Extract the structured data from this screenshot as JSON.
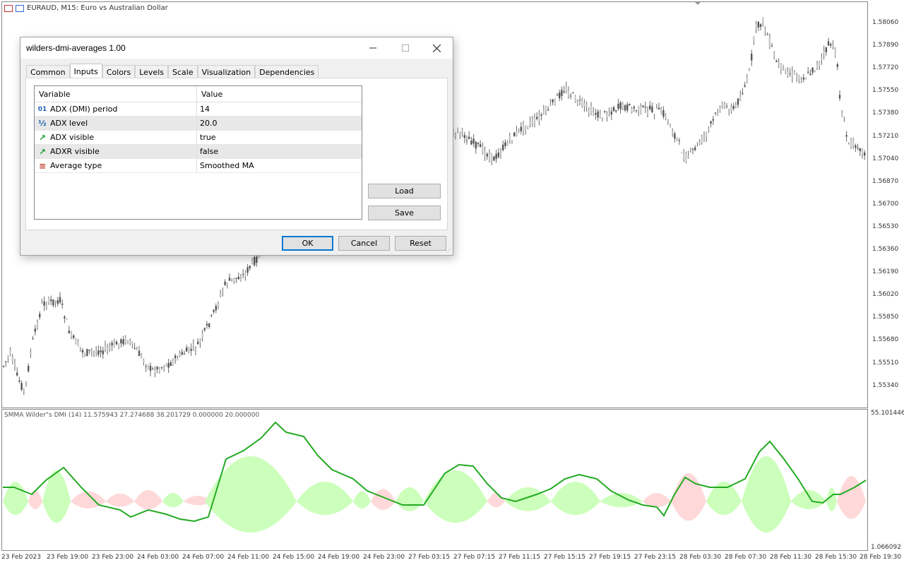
{
  "chart": {
    "title": "EURAUD, M15:  Euro vs Australian Dollar",
    "indicator_label": "SMMA Wilder\"s DMI (14) 11.575943 27.274688 38.201729 0.000000 20.000000",
    "price_axis": [
      "1.58060",
      "1.57890",
      "1.57720",
      "1.57550",
      "1.57380",
      "1.57210",
      "1.57040",
      "1.56870",
      "1.56700",
      "1.56530",
      "1.56360",
      "1.56190",
      "1.56020",
      "1.55850",
      "1.55680",
      "1.55510",
      "1.55340"
    ],
    "indicator_axis": {
      "max": "55.101446",
      "min": "1.066092"
    },
    "time_axis": [
      "23 Feb 2023",
      "23 Feb 19:00",
      "23 Feb 23:00",
      "24 Feb 03:00",
      "24 Feb 07:00",
      "24 Feb 11:00",
      "24 Feb 15:00",
      "24 Feb 19:00",
      "24 Feb 23:00",
      "27 Feb 03:15",
      "27 Feb 07:15",
      "27 Feb 11:15",
      "27 Feb 15:15",
      "27 Feb 19:15",
      "27 Feb 23:15",
      "28 Feb 03:30",
      "28 Feb 07:30",
      "28 Feb 11:30",
      "28 Feb 15:30",
      "28 Feb 19:30"
    ],
    "colors": {
      "bull_fill": "#ccffbb",
      "bear_fill": "#ffd9d9",
      "adx_line": "#22aa22",
      "candle": "#555555"
    }
  },
  "dialog": {
    "title": "wilders-dmi-averages 1.00",
    "tabs": [
      "Common",
      "Inputs",
      "Colors",
      "Levels",
      "Scale",
      "Visualization",
      "Dependencies"
    ],
    "active_tab": "Inputs",
    "columns": {
      "variable": "Variable",
      "value": "Value"
    },
    "rows": [
      {
        "icon": "01",
        "icon_name": "integer-icon",
        "variable": "ADX (DMI) period",
        "value": "14"
      },
      {
        "icon": "½",
        "icon_name": "double-icon",
        "variable": "ADX level",
        "value": "20.0"
      },
      {
        "icon": "↗",
        "icon_name": "boolean-icon",
        "variable": "ADX visible",
        "value": "true"
      },
      {
        "icon": "↗",
        "icon_name": "boolean-icon",
        "variable": "ADXR visible",
        "value": "false"
      },
      {
        "icon": "≡",
        "icon_name": "enum-icon",
        "variable": "Average type",
        "value": "Smoothed MA"
      }
    ],
    "buttons": {
      "load": "Load",
      "save": "Save",
      "ok": "OK",
      "cancel": "Cancel",
      "reset": "Reset"
    }
  }
}
